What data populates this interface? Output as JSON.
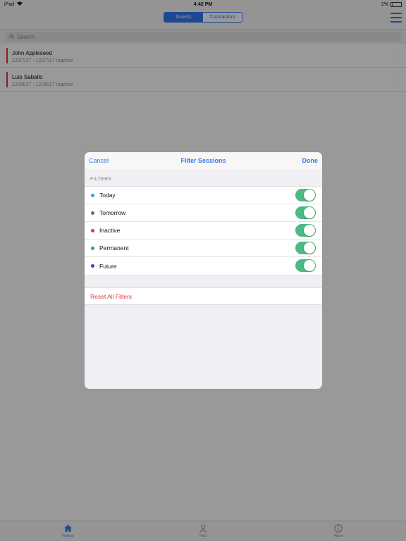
{
  "status_bar": {
    "device": "iPad",
    "time": "4:42 PM",
    "battery": "2%"
  },
  "navbar": {
    "segments": [
      {
        "label": "Guests",
        "selected": true
      },
      {
        "label": "Contractors",
        "selected": false
      }
    ]
  },
  "search": {
    "placeholder": "Search"
  },
  "visitors": [
    {
      "name": "John Appleseed",
      "detail": "12/27/17 - 12/27/17 Inactive"
    },
    {
      "name": "Luis Saballo",
      "detail": "12/26/17 - 12/26/17 Inactive"
    }
  ],
  "modal": {
    "cancel": "Cancel",
    "title": "Filter Sessions",
    "done": "Done",
    "section_label": "FILTERS",
    "filters": [
      {
        "label": "Today",
        "color": "#1fa8e0",
        "on": true
      },
      {
        "label": "Tomorrow",
        "color": "#607080",
        "on": true
      },
      {
        "label": "Inactive",
        "color": "#e53935",
        "on": true
      },
      {
        "label": "Permanent",
        "color": "#43a047",
        "on": true
      },
      {
        "label": "Future",
        "color": "#5e35b1",
        "on": true
      }
    ],
    "reset": "Reset All Filters"
  },
  "tabbar": {
    "tabs": [
      {
        "label": "Visitors",
        "icon": "house-icon",
        "active": true
      },
      {
        "label": "New",
        "icon": "person-add-icon",
        "active": false
      },
      {
        "label": "About",
        "icon": "info-icon",
        "active": false
      }
    ]
  }
}
